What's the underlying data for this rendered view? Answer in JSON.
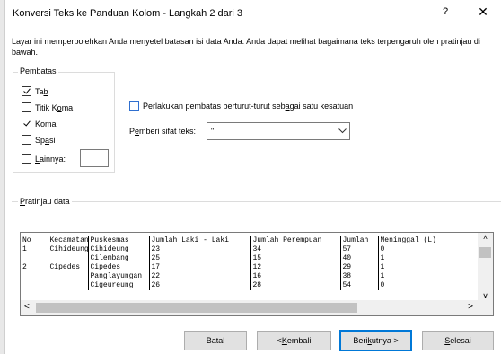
{
  "window": {
    "title": "Konversi Teks ke Panduan Kolom - Langkah 2 dari 3",
    "help": "?",
    "close": "✕"
  },
  "description": "Layar ini memperbolehkan Anda menyetel batasan isi data Anda. Anda dapat melihat bagaimana teks terpengaruh oleh pratinjau di bawah.",
  "delimiters": {
    "title": "Pembatas",
    "tab": {
      "label_pre": "Ta",
      "label_u": "b",
      "label_post": "",
      "checked": true
    },
    "semicolon": {
      "label_pre": "Titik K",
      "label_u": "o",
      "label_post": "ma",
      "checked": false
    },
    "comma": {
      "label_pre": "",
      "label_u": "K",
      "label_post": "oma",
      "checked": true
    },
    "space": {
      "label_pre": "Sp",
      "label_u": "a",
      "label_post": "si",
      "checked": false
    },
    "other": {
      "label_pre": "",
      "label_u": "L",
      "label_post": "ainnya:",
      "checked": false,
      "value": ""
    }
  },
  "treat_consecutive": {
    "label_pre": "Perlakukan pembatas berturut-turut seb",
    "label_u": "a",
    "label_post": "gai satu kesatuan",
    "checked": false
  },
  "qualifier": {
    "label_pre": "P",
    "label_u": "e",
    "label_post": "mberi sifat teks:",
    "value": "\""
  },
  "preview": {
    "title_u": "P",
    "title_post": "ratinjau data",
    "rows": [
      [
        "No",
        "Kecamatan",
        "Puskesmas",
        "Jumlah Laki - Laki",
        "Jumlah Perempuan",
        "Jumlah",
        "Meninggal (L)"
      ],
      [
        "1",
        "Cihideung",
        "Cihideung",
        "23",
        "34",
        "57",
        "0"
      ],
      [
        "",
        "",
        "Cilembang",
        "25",
        "15",
        "40",
        "1"
      ],
      [
        "2",
        "Cipedes",
        "Cipedes",
        "17",
        "12",
        "29",
        "1"
      ],
      [
        "",
        "",
        "Panglayungan",
        "22",
        "16",
        "38",
        "1"
      ],
      [
        "",
        "",
        "Cigeureung",
        "26",
        "28",
        "54",
        "0"
      ]
    ]
  },
  "buttons": {
    "cancel": "Batal",
    "back_pre": "< ",
    "back_u": "K",
    "back_post": "embali",
    "next_pre": "Beri",
    "next_u": "k",
    "next_post": "utnya >",
    "finish_u": "S",
    "finish_post": "elesai"
  }
}
